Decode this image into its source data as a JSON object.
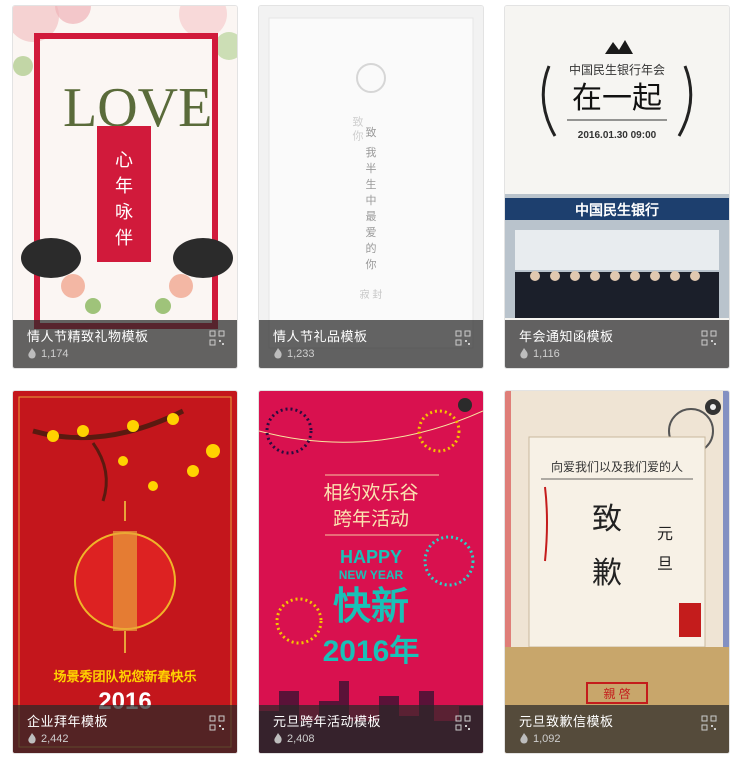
{
  "cards": [
    {
      "title": "情人节精致礼物模板",
      "views": "1,174"
    },
    {
      "title": "情人节礼品模板",
      "views": "1,233"
    },
    {
      "title": "年会通知函模板",
      "views": "1,116"
    },
    {
      "title": "企业拜年模板",
      "views": "2,442"
    },
    {
      "title": "元旦跨年活动模板",
      "views": "2,408"
    },
    {
      "title": "元旦致歉信模板",
      "views": "1,092"
    }
  ],
  "art": {
    "c1": {
      "love": "LOVE",
      "poem": [
        "心",
        "年",
        "咏",
        "伴"
      ]
    },
    "c2": {
      "line1": [
        "致",
        "我",
        "半",
        "生",
        "中",
        "最",
        "爱",
        "的",
        "你"
      ],
      "stamp": "致 你",
      "seal": "寂 封"
    },
    "c3": {
      "org": "中国民生银行年会",
      "main": "在一起",
      "date": "2016.01.30 09:00",
      "sign": "中国民生银行"
    },
    "c4": {
      "greet": "场景秀团队祝您新春快乐",
      "year": "2016"
    },
    "c5": {
      "t1": "相约欢乐谷",
      "t2": "跨年活动",
      "happy": "HAPPY",
      "ny": "NEW YEAR",
      "kx": "快新",
      "year": "2016年"
    },
    "c6": {
      "top": "向爱我们以及我们爱的人",
      "zhi": "致",
      "qian": "歉",
      "yuan": "元",
      "dan": "旦",
      "seal": "親 啓"
    }
  },
  "colors": {
    "accent_red": "#d11a3b",
    "overlay": "rgba(40,40,40,0.72)",
    "cny_red": "#c4161c",
    "party_pink": "#d9114f",
    "teal": "#19c1b7"
  }
}
